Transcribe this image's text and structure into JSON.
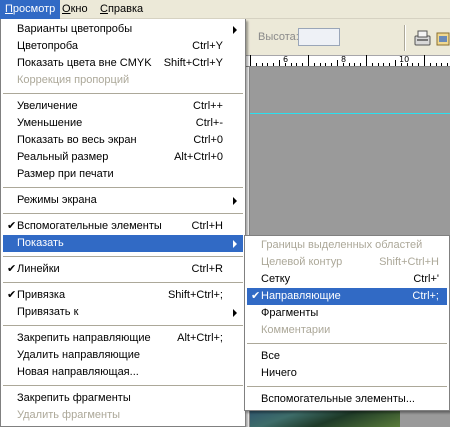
{
  "menubar": {
    "items": [
      {
        "label": "Просмотр",
        "mnemonic": "П",
        "rest": "росмотр"
      },
      {
        "label": "Окно",
        "mnemonic": "О",
        "rest": "кно"
      },
      {
        "label": "Справка",
        "mnemonic": "С",
        "rest": "правка"
      }
    ]
  },
  "options_bar": {
    "height_label": "Высота:",
    "height_value": ""
  },
  "ruler": {
    "labels": [
      "6",
      "8",
      "10"
    ]
  },
  "view_menu": {
    "groups": [
      [
        {
          "label": "Варианты цветопробы",
          "shortcut": "",
          "submenu": true,
          "disabled": false,
          "checked": false
        },
        {
          "label": "Цветопроба",
          "shortcut": "Ctrl+Y",
          "submenu": false,
          "disabled": false,
          "checked": false
        },
        {
          "label": "Показать цвета вне CMYK",
          "shortcut": "Shift+Ctrl+Y",
          "submenu": false,
          "disabled": false,
          "checked": false
        },
        {
          "label": "Коррекция пропорций",
          "shortcut": "",
          "submenu": false,
          "disabled": true,
          "checked": false
        }
      ],
      [
        {
          "label": "Увеличение",
          "shortcut": "Ctrl++",
          "submenu": false,
          "disabled": false,
          "checked": false
        },
        {
          "label": "Уменьшение",
          "shortcut": "Ctrl+-",
          "submenu": false,
          "disabled": false,
          "checked": false
        },
        {
          "label": "Показать во весь экран",
          "shortcut": "Ctrl+0",
          "submenu": false,
          "disabled": false,
          "checked": false
        },
        {
          "label": "Реальный размер",
          "shortcut": "Alt+Ctrl+0",
          "submenu": false,
          "disabled": false,
          "checked": false
        },
        {
          "label": "Размер при печати",
          "shortcut": "",
          "submenu": false,
          "disabled": false,
          "checked": false
        }
      ],
      [
        {
          "label": "Режимы экрана",
          "shortcut": "",
          "submenu": true,
          "disabled": false,
          "checked": false
        }
      ],
      [
        {
          "label": "Вспомогательные элементы",
          "shortcut": "Ctrl+H",
          "submenu": false,
          "disabled": false,
          "checked": true
        },
        {
          "label": "Показать",
          "shortcut": "",
          "submenu": true,
          "disabled": false,
          "checked": false,
          "highlighted": true
        }
      ],
      [
        {
          "label": "Линейки",
          "shortcut": "Ctrl+R",
          "submenu": false,
          "disabled": false,
          "checked": true
        }
      ],
      [
        {
          "label": "Привязка",
          "shortcut": "Shift+Ctrl+;",
          "submenu": false,
          "disabled": false,
          "checked": true
        },
        {
          "label": "Привязать к",
          "shortcut": "",
          "submenu": true,
          "disabled": false,
          "checked": false
        }
      ],
      [
        {
          "label": "Закрепить направляющие",
          "shortcut": "Alt+Ctrl+;",
          "submenu": false,
          "disabled": false,
          "checked": false
        },
        {
          "label": "Удалить направляющие",
          "shortcut": "",
          "submenu": false,
          "disabled": false,
          "checked": false
        },
        {
          "label": "Новая направляющая...",
          "shortcut": "",
          "submenu": false,
          "disabled": false,
          "checked": false
        }
      ],
      [
        {
          "label": "Закрепить фрагменты",
          "shortcut": "",
          "submenu": false,
          "disabled": false,
          "checked": false
        },
        {
          "label": "Удалить фрагменты",
          "shortcut": "",
          "submenu": false,
          "disabled": true,
          "checked": false
        }
      ]
    ]
  },
  "show_submenu": {
    "groups": [
      [
        {
          "label": "Границы выделенных областей",
          "shortcut": "",
          "disabled": true,
          "checked": false
        },
        {
          "label": "Целевой контур",
          "shortcut": "Shift+Ctrl+H",
          "disabled": true,
          "checked": false
        },
        {
          "label": "Сетку",
          "shortcut": "Ctrl+'",
          "disabled": false,
          "checked": false
        },
        {
          "label": "Направляющие",
          "shortcut": "Ctrl+;",
          "disabled": false,
          "checked": true,
          "highlighted": true
        },
        {
          "label": "Фрагменты",
          "shortcut": "",
          "disabled": false,
          "checked": false
        },
        {
          "label": "Комментарии",
          "shortcut": "",
          "disabled": true,
          "checked": false
        }
      ],
      [
        {
          "label": "Все",
          "shortcut": "",
          "disabled": false,
          "checked": false
        },
        {
          "label": "Ничего",
          "shortcut": "",
          "disabled": false,
          "checked": false
        }
      ],
      [
        {
          "label": "Вспомогательные элементы...",
          "shortcut": "",
          "disabled": false,
          "checked": false
        }
      ]
    ]
  },
  "colors": {
    "menu_highlight": "#316ac5",
    "menubar_bg": "#ece9d8",
    "guide": "#2ce0ef"
  }
}
